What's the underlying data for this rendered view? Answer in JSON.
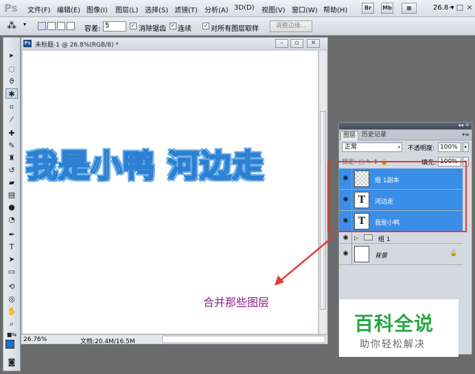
{
  "app": {
    "logo": "Ps",
    "menu": [
      "文件(F)",
      "编辑(E)",
      "图像(I)",
      "图层(L)",
      "选择(S)",
      "滤镜(T)",
      "分析(A)",
      "3D(D)",
      "视图(V)",
      "窗口(W)",
      "帮助(H)"
    ],
    "menubar_buttons": [
      "Br",
      "Mb"
    ],
    "zoom": "26.8",
    "window_controls": [
      "-",
      "□",
      "×"
    ]
  },
  "options": {
    "tolerance_label": "容差:",
    "tolerance_value": "5",
    "antialias_label": "消除锯齿",
    "contiguous_label": "连续",
    "sample_all_label": "对所有图层取样",
    "refine_edge": "调整边缘..."
  },
  "document": {
    "title": "未标题-1 @ 26.8%(RGB/8) *",
    "zoom": "26.76%",
    "info": "文档:20.4M/16.5M",
    "artwork_part1": "我是小鸭",
    "artwork_part2": "河边走"
  },
  "annotation": "合并那些图层",
  "layers_panel": {
    "tabs": [
      "图层",
      "历史记录"
    ],
    "blend_mode": "正常",
    "opacity_label": "不透明度:",
    "opacity_value": "100%",
    "lock_label": "锁定:",
    "fill_label": "填充:",
    "fill_value": "100%",
    "layers": [
      {
        "name": "组 1副本",
        "selected": true
      },
      {
        "name": "河边走",
        "selected": true,
        "thumb": "T"
      },
      {
        "name": "我是小鸭",
        "selected": true,
        "thumb": "T"
      },
      {
        "name": "组 1",
        "selected": false
      },
      {
        "name": "背景",
        "selected": false
      }
    ]
  },
  "watermark": {
    "title": "百科全说",
    "subtitle": "助你轻松解决"
  },
  "colors": {
    "selection": "#3b8ee8",
    "annotation": "#8b1f8b",
    "highlight_box": "#e23a3a",
    "watermark_green": "#28a745",
    "foreground": "#1a73c9"
  }
}
